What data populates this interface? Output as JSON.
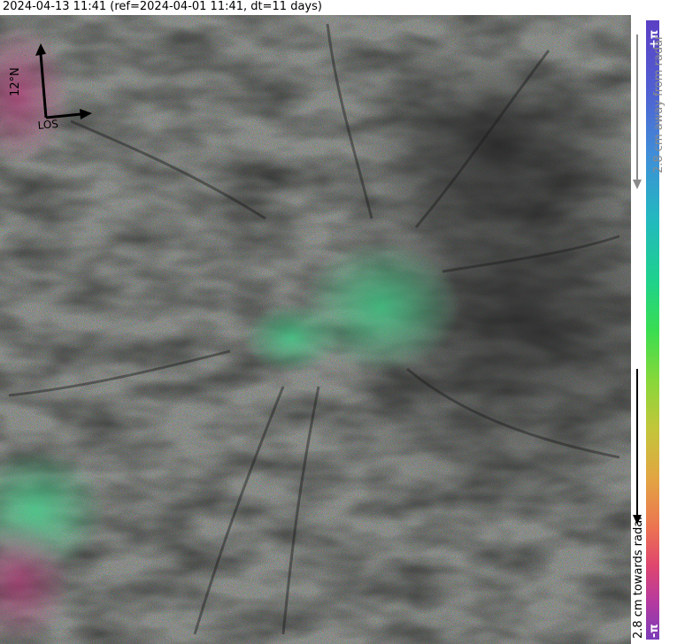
{
  "header": {
    "title": "2024-04-13 11:41 (ref=2024-04-01 11:41, dt=11 days)"
  },
  "map": {
    "north_arrow_label": "12°N",
    "los_label": "LOS"
  },
  "colorbar": {
    "top_label": "+π",
    "bottom_label": "-π",
    "away_label": "2.8 cm away from radar",
    "towards_label": "2.8 cm towards radar"
  }
}
